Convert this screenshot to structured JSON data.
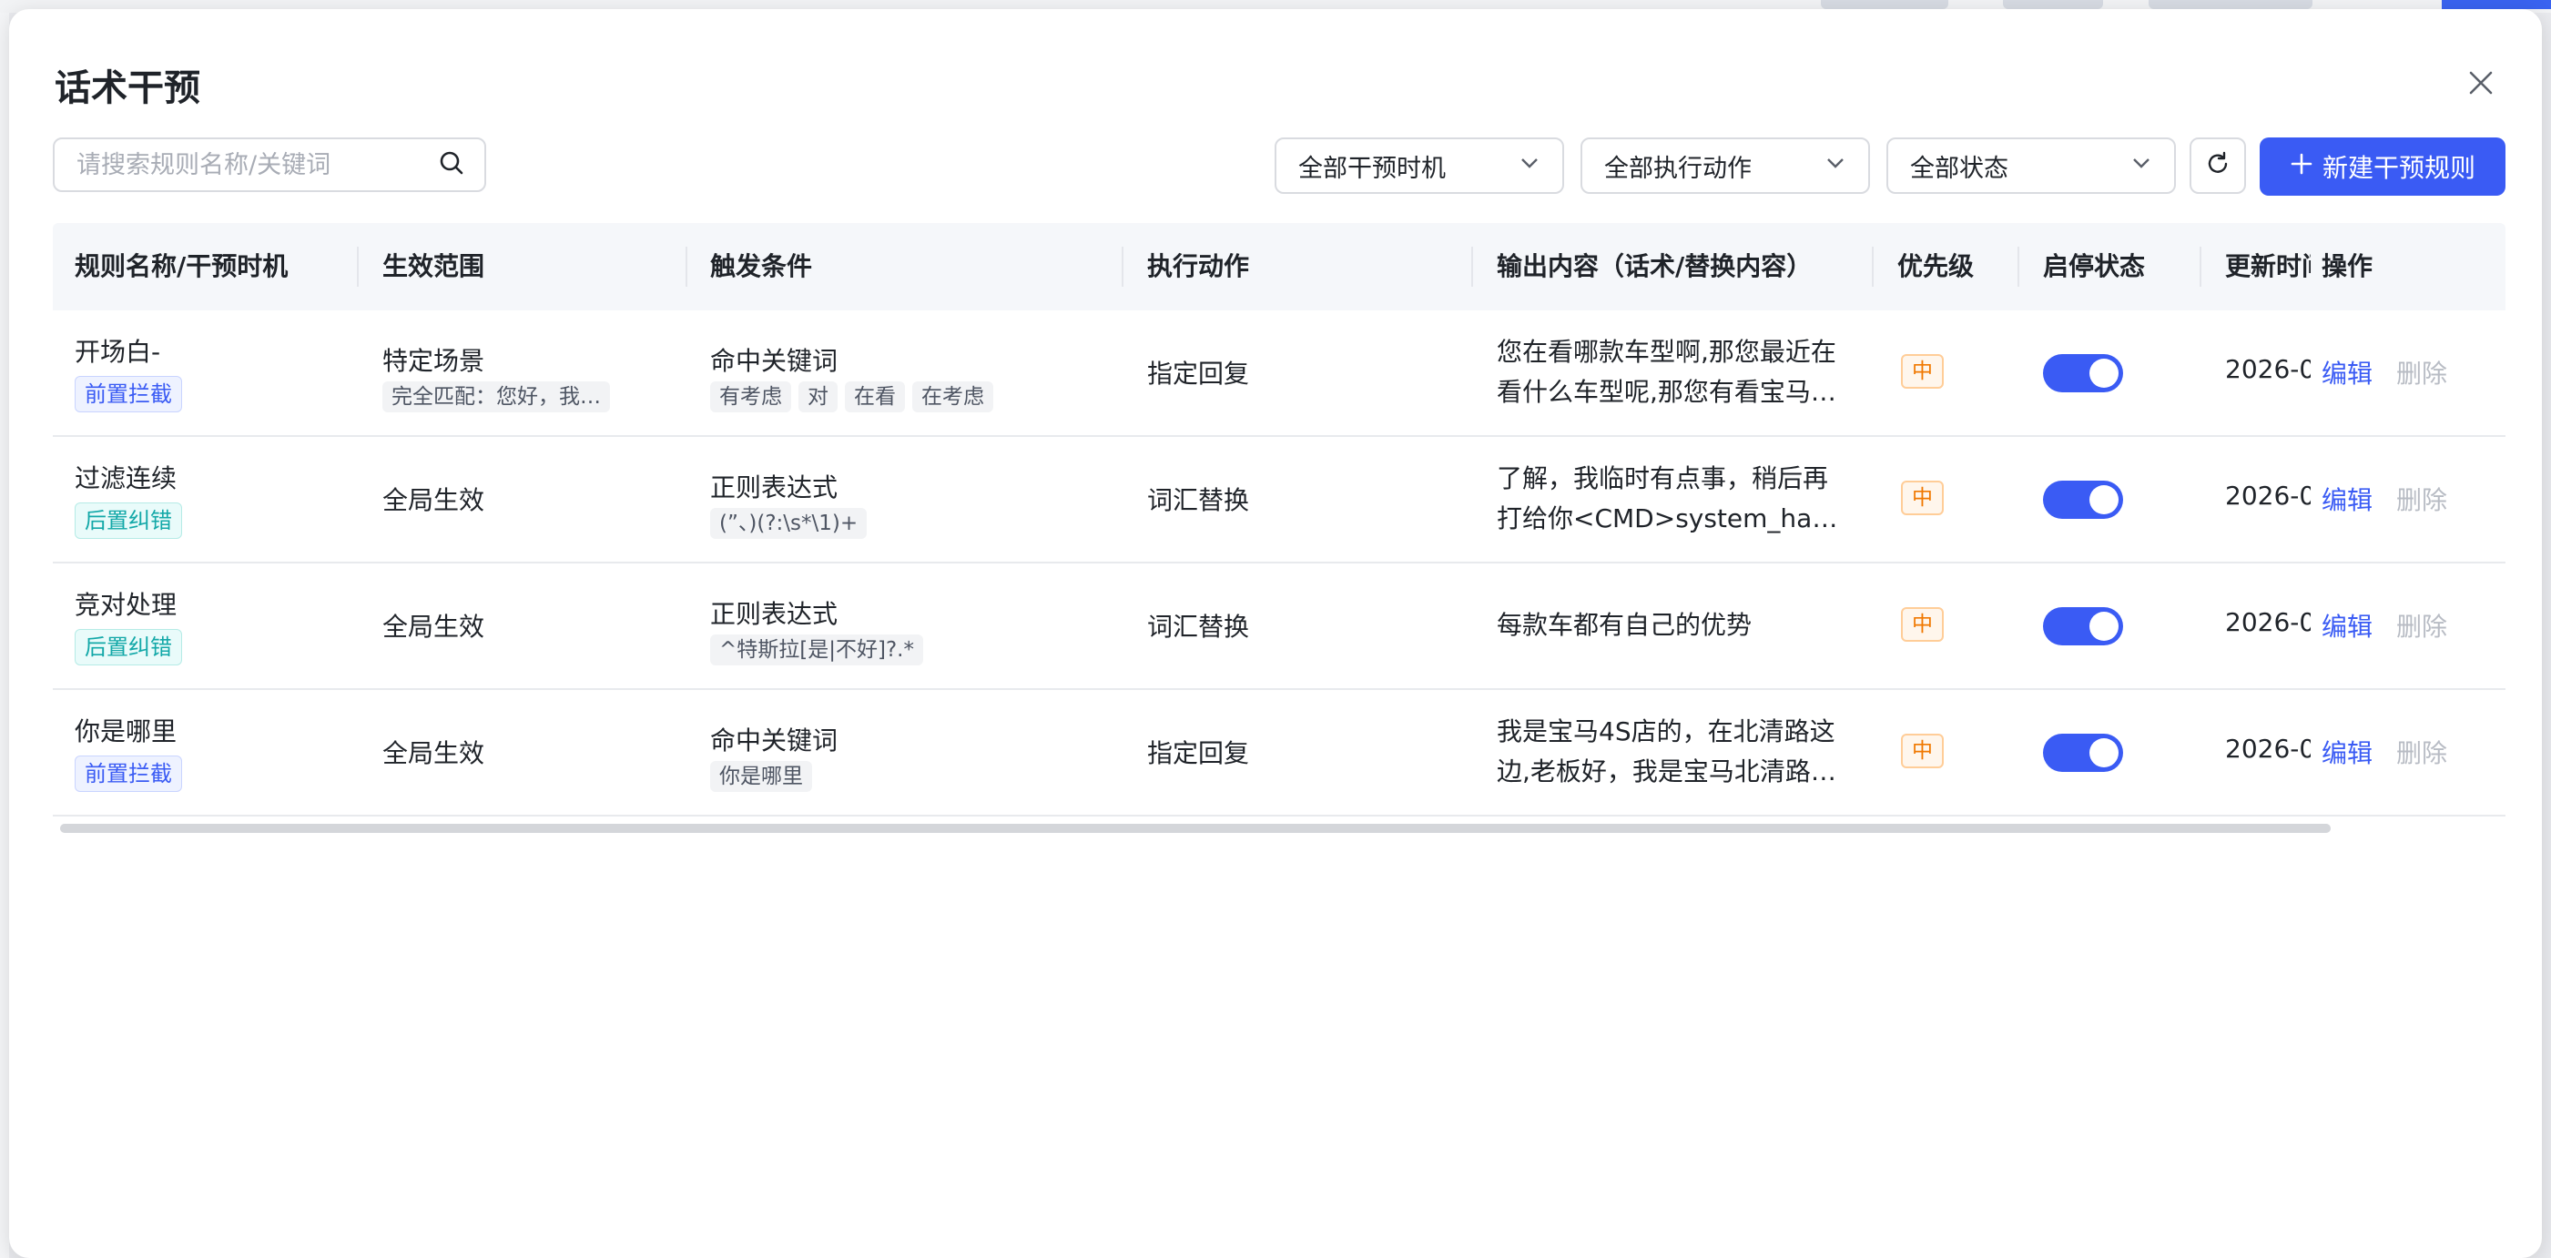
{
  "modal": {
    "title": "话术干预"
  },
  "toolbar": {
    "search_placeholder": "请搜索规则名称/关键词",
    "filter_timing": "全部干预时机",
    "filter_action": "全部执行动作",
    "filter_status": "全部状态",
    "new_button": "新建干预规则"
  },
  "columns": [
    "规则名称/干预时机",
    "生效范围",
    "触发条件",
    "执行动作",
    "输出内容（话术/替换内容）",
    "优先级",
    "启停状态",
    "更新时间",
    "操作"
  ],
  "rows": [
    {
      "name": "开场白-",
      "timing": "前置拦截",
      "timing_type": "blue",
      "scope": "特定场景",
      "scope_detail": "完全匹配：您好，我…",
      "trigger": "命中关键词",
      "trigger_chips": [
        "有考虑",
        "对",
        "在看",
        "在考虑"
      ],
      "action": "指定回复",
      "output": "您在看哪款车型啊,那您最近在看什么车型呢,那您有看宝马…",
      "priority": "中",
      "enabled": true,
      "updated": "2026-0",
      "edit": "编辑",
      "delete": "删除"
    },
    {
      "name": "过滤连续",
      "timing": "后置纠错",
      "timing_type": "cyan",
      "scope": "全局生效",
      "scope_detail": "",
      "trigger": "正则表达式",
      "trigger_chips": [
        "(”、)(?:\\s*\\1)+"
      ],
      "action": "词汇替换",
      "output": "了解，我临时有点事，稍后再打给你<CMD>system_hang…",
      "priority": "中",
      "enabled": true,
      "updated": "2026-0",
      "edit": "编辑",
      "delete": "删除"
    },
    {
      "name": "竞对处理",
      "timing": "后置纠错",
      "timing_type": "cyan",
      "scope": "全局生效",
      "scope_detail": "",
      "trigger": "正则表达式",
      "trigger_chips": [
        "^特斯拉[是|不好]?.*"
      ],
      "action": "词汇替换",
      "output": "每款车都有自己的优势",
      "priority": "中",
      "enabled": true,
      "updated": "2026-0",
      "edit": "编辑",
      "delete": "删除"
    },
    {
      "name": "你是哪里",
      "timing": "前置拦截",
      "timing_type": "blue",
      "scope": "全局生效",
      "scope_detail": "",
      "trigger": "命中关键词",
      "trigger_chips": [
        "你是哪里"
      ],
      "action": "指定回复",
      "output": "我是宝马4S店的，在北清路这边,老板好，我是宝马北清路…",
      "priority": "中",
      "enabled": true,
      "updated": "2026-0",
      "edit": "编辑",
      "delete": "删除"
    }
  ],
  "colors": {
    "primary": "#3a5bf4",
    "priority_orange": "#f07800",
    "tag_cyan": "#13a8a8"
  }
}
